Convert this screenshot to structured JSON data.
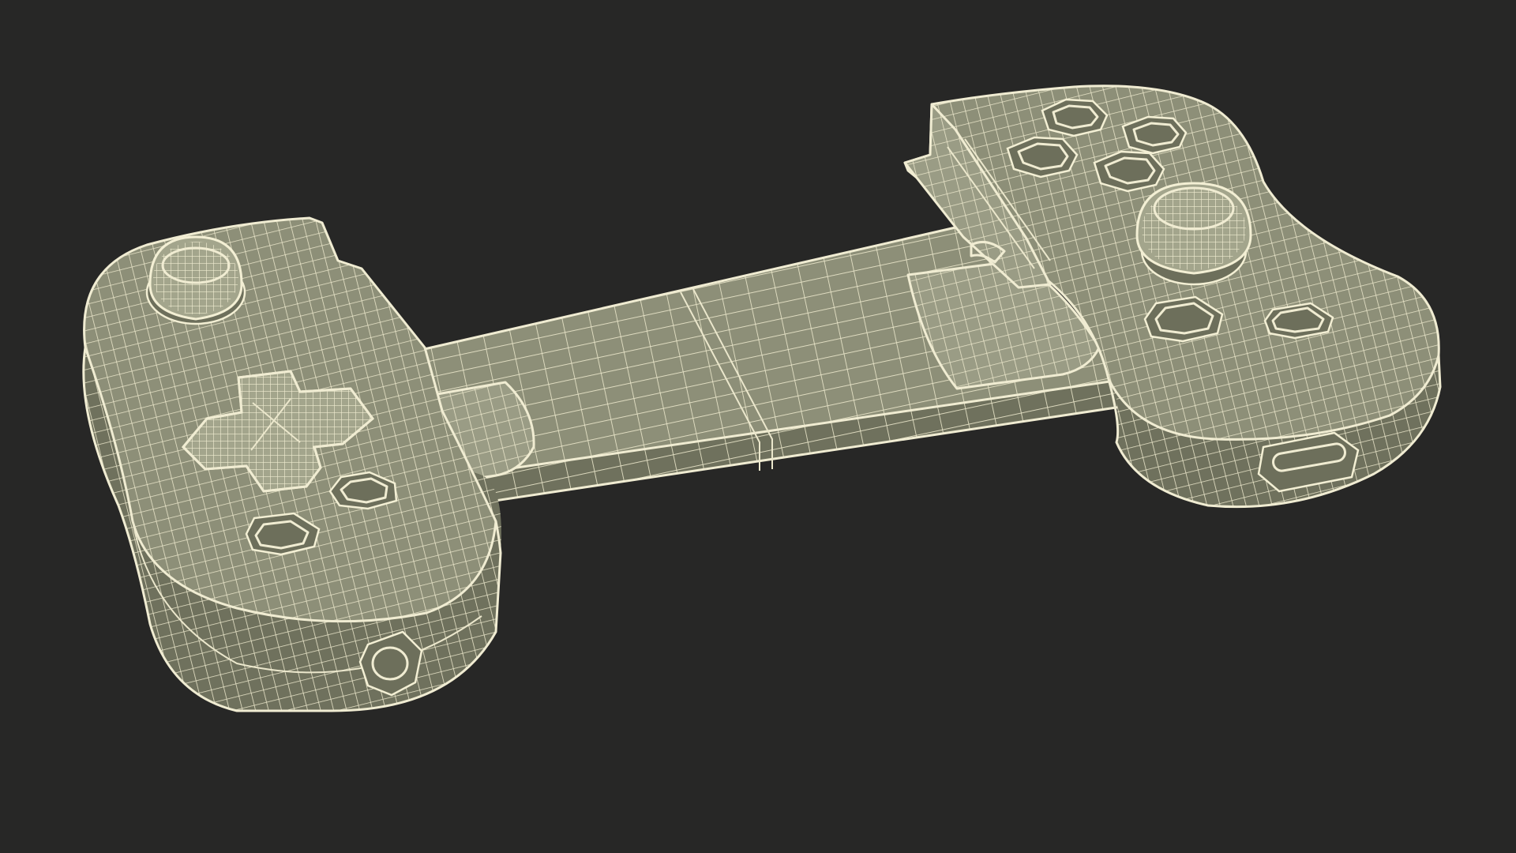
{
  "scene": {
    "subject": "game-controller-wireframe",
    "colors": {
      "background": "#272726",
      "body": "#8d8f78",
      "body_light": "#9a9c85",
      "body_dark": "#6f715d",
      "wire": "#f0ecd2"
    },
    "icons": {
      "thumbsticks": [
        "thumbstick-icon",
        "thumbstick-icon"
      ],
      "dpad": "dpad-icon",
      "face_buttons": [
        "face-button-icon",
        "face-button-icon",
        "face-button-icon",
        "face-button-icon"
      ],
      "port": "usb-c-port-icon"
    }
  }
}
